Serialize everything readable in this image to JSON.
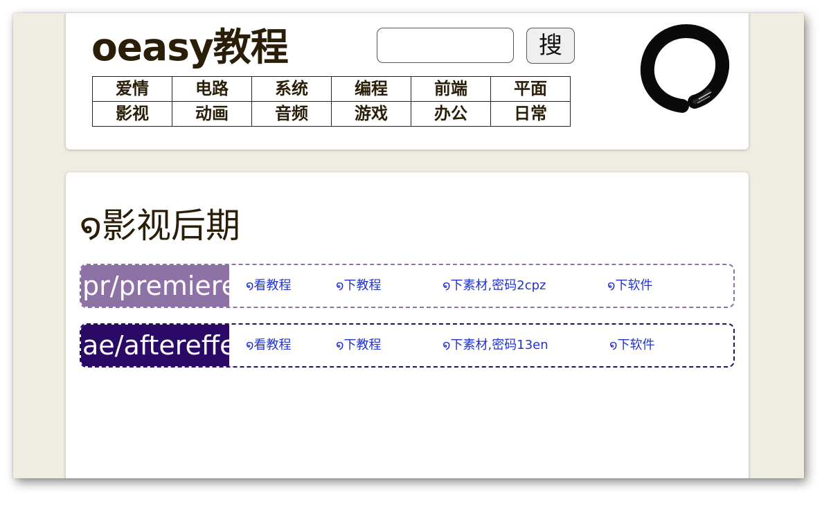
{
  "header": {
    "site_title": "oeasy教程",
    "search_placeholder": "",
    "search_button_label": "搜",
    "nav_rows": [
      [
        "爱情",
        "电路",
        "系统",
        "编程",
        "前端",
        "平面"
      ],
      [
        "影视",
        "动画",
        "音频",
        "游戏",
        "办公",
        "日常"
      ]
    ]
  },
  "content": {
    "swirl_glyph": "໑",
    "section_title": "影视后期",
    "courses": [
      {
        "name": "pr/premiere",
        "color": "#8e72a6",
        "links": [
          "໑看教程",
          "໑下教程",
          "໑下素材,密码2cpz",
          "໑下软件"
        ]
      },
      {
        "name": "ae/aftereffects",
        "color": "#2a0a66",
        "links": [
          "໑看教程",
          "໑下教程",
          "໑下素材,密码13en",
          "໑下软件"
        ]
      }
    ]
  },
  "colors": {
    "page_background": "#efede1",
    "title_text": "#2b1e08",
    "link_text": "#2233cc"
  },
  "icons": {
    "logo": "enso-circle-icon"
  }
}
